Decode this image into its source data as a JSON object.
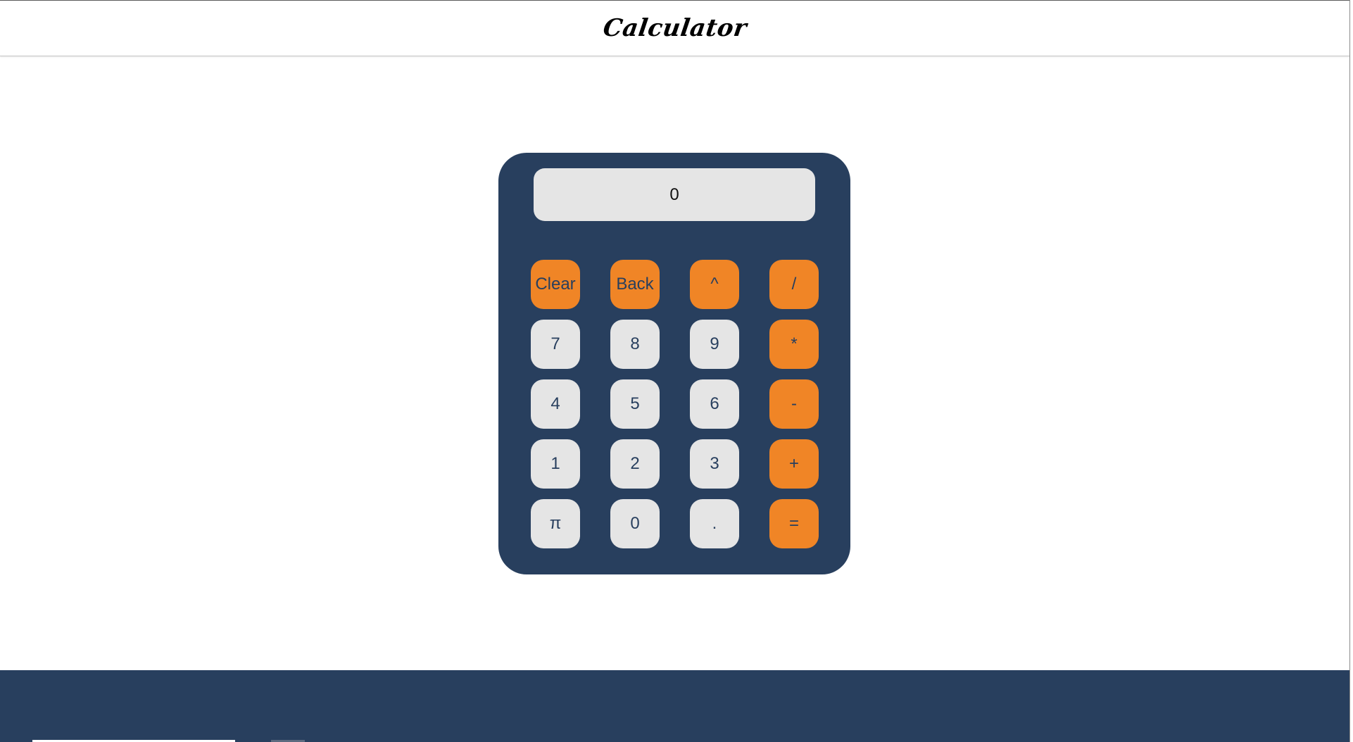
{
  "header": {
    "title": "Calculator"
  },
  "display": {
    "value": "0"
  },
  "keys": [
    {
      "label": "Clear",
      "kind": "op",
      "name": "clear-button"
    },
    {
      "label": "Back",
      "kind": "op",
      "name": "back-button"
    },
    {
      "label": "^",
      "kind": "op",
      "name": "power-button"
    },
    {
      "label": "/",
      "kind": "op",
      "name": "divide-button"
    },
    {
      "label": "7",
      "kind": "num",
      "name": "digit-7-button"
    },
    {
      "label": "8",
      "kind": "num",
      "name": "digit-8-button"
    },
    {
      "label": "9",
      "kind": "num",
      "name": "digit-9-button"
    },
    {
      "label": "*",
      "kind": "op",
      "name": "multiply-button"
    },
    {
      "label": "4",
      "kind": "num",
      "name": "digit-4-button"
    },
    {
      "label": "5",
      "kind": "num",
      "name": "digit-5-button"
    },
    {
      "label": "6",
      "kind": "num",
      "name": "digit-6-button"
    },
    {
      "label": "-",
      "kind": "op",
      "name": "subtract-button"
    },
    {
      "label": "1",
      "kind": "num",
      "name": "digit-1-button"
    },
    {
      "label": "2",
      "kind": "num",
      "name": "digit-2-button"
    },
    {
      "label": "3",
      "kind": "num",
      "name": "digit-3-button"
    },
    {
      "label": "+",
      "kind": "op",
      "name": "add-button"
    },
    {
      "label": "π",
      "kind": "num",
      "name": "pi-button"
    },
    {
      "label": "0",
      "kind": "num",
      "name": "digit-0-button"
    },
    {
      "label": ".",
      "kind": "num",
      "name": "decimal-point-button"
    },
    {
      "label": "=",
      "kind": "op",
      "name": "equals-button"
    }
  ],
  "colors": {
    "calculator_body": "#283f5e",
    "operator_key": "#f08526",
    "number_key": "#e5e5e5",
    "key_text": "#283f5e",
    "footer": "#283f5e"
  }
}
